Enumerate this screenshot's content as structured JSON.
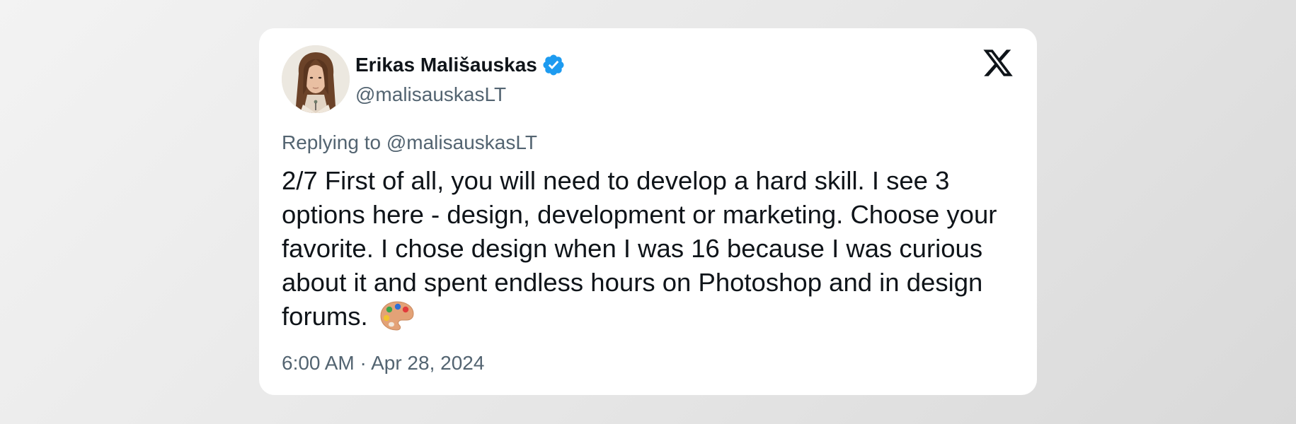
{
  "tweet": {
    "author": {
      "display_name": "Erikas Mališauskas",
      "handle": "@malisauskasLT",
      "verified": true,
      "avatar_icon": "avatar-portrait"
    },
    "platform_icon": "x-logo-icon",
    "replying_to": "Replying to @malisauskasLT",
    "text": "2/7 First of all, you will need to develop a hard skill. I see 3 options here - design, development or marketing. Choose your favorite. I chose design when I was 16 because I was curious about it and spent endless hours on Photoshop and in design forums.",
    "emoji": "artist-palette-icon",
    "timestamp": "6:00 AM · Apr 28, 2024"
  },
  "colors": {
    "text_primary": "#0f1419",
    "text_secondary": "#536471",
    "verified_blue": "#1d9bf0",
    "card_background": "#ffffff"
  }
}
